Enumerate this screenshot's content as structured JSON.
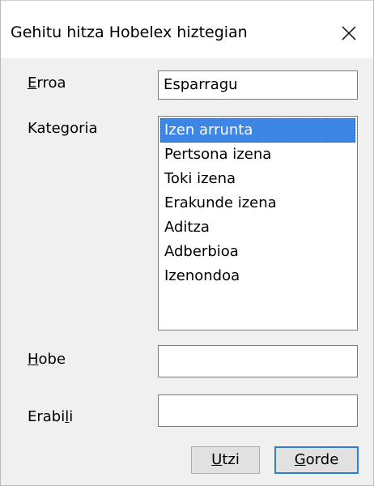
{
  "window": {
    "title": "Gehitu hitza Hobelex hiztegian",
    "close_glyph": "×"
  },
  "form": {
    "erroa": {
      "label_mnemonic": "E",
      "label_rest": "rroa",
      "value": "Esparragu"
    },
    "kategoria": {
      "label": "Kategoria",
      "options": [
        "Izen arrunta",
        "Pertsona izena",
        "Toki izena",
        "Erakunde izena",
        "Aditza",
        "Adberbioa",
        "Izenondoa"
      ],
      "selected_index": 0
    },
    "hobe": {
      "label_mnemonic": "H",
      "label_rest": "obe",
      "value": ""
    },
    "erabili": {
      "label_before": "Erabi",
      "label_mnemonic": "l",
      "label_rest": "i",
      "value": ""
    }
  },
  "buttons": {
    "cancel": {
      "mnemonic": "U",
      "rest": "tzi"
    },
    "save": {
      "mnemonic": "G",
      "rest": "orde"
    }
  },
  "colors": {
    "selection": "#3d86e6",
    "default_button_border": "#2b7fd6",
    "dialog_bg": "#f0f0f0"
  },
  "icons": {
    "close": "close-icon"
  }
}
